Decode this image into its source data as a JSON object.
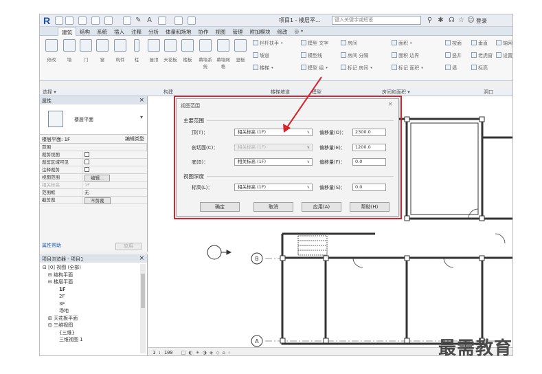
{
  "app": {
    "logo_letter": "R",
    "doc_title": "项目1 - 楼层平...",
    "help_search_placeholder": "键入关键字或短语",
    "login_label": "登录"
  },
  "ribbon": {
    "tabs": [
      "建筑",
      "结构",
      "系统",
      "插入",
      "注释",
      "分析",
      "体量和场地",
      "协作",
      "视图",
      "管理",
      "附加模块",
      "修改",
      "◎ •"
    ],
    "active_tab": "建筑",
    "buttons": [
      "修改",
      "墙",
      "门",
      "窗",
      "构件",
      "柱",
      "屋顶",
      "天花板",
      "楼板",
      "幕墙系统",
      "幕墙网格",
      "竖梃"
    ],
    "small_items": [
      "栏杆扶手 •",
      "坡道",
      "楼梯 •",
      "模型 文字",
      "模型线",
      "模型 组 •",
      "房间",
      "房间 分隔",
      "标记 房间 •",
      "面积 •",
      "面积 边界",
      "标记 面积 •",
      "按面",
      "竖井",
      "墙",
      "垂直",
      "老虎窗",
      "标高",
      "轴网",
      "设置"
    ],
    "panel_labels": [
      "选择 ▾",
      "构建",
      "楼梯坡道",
      "模型",
      "房间和面积 ▾",
      "洞口"
    ]
  },
  "properties": {
    "title": "属性",
    "type_name": "楼层平面",
    "instance_label": "楼层平面: 1F",
    "edit_type": "编辑类型",
    "section": "范围",
    "rows": [
      {
        "key": "裁剪视图",
        "value": "",
        "checkbox": true,
        "dim": false
      },
      {
        "key": "裁剪区域可见",
        "value": "",
        "checkbox": true,
        "dim": false
      },
      {
        "key": "注释裁剪",
        "value": "",
        "checkbox": true,
        "dim": false
      },
      {
        "key": "视图范围",
        "value": "编辑...",
        "button": true,
        "dim": false
      },
      {
        "key": "相关标高",
        "value": "1F",
        "dim": true
      },
      {
        "key": "范围框",
        "value": "无",
        "dim": false
      },
      {
        "key": "截剪裁",
        "value": "不剪裁",
        "button": true,
        "dim": false
      }
    ],
    "help_link": "属性帮助",
    "apply": "应用"
  },
  "browser": {
    "title": "项目浏览器 - 项目1",
    "tree": [
      {
        "text": "⊟ [0] 视图 (全部)",
        "indent": 0
      },
      {
        "text": "⊟ 结构平面",
        "indent": 1
      },
      {
        "text": "⊟ 楼层平面",
        "indent": 1
      },
      {
        "text": "1F",
        "indent": 3,
        "bold": true
      },
      {
        "text": "2F",
        "indent": 3
      },
      {
        "text": "3F",
        "indent": 3
      },
      {
        "text": "场地",
        "indent": 3
      },
      {
        "text": "⊞ 天花板平面",
        "indent": 1
      },
      {
        "text": "⊟ 三维视图",
        "indent": 1
      },
      {
        "text": "{三维}",
        "indent": 3
      },
      {
        "text": "三维视图 1",
        "indent": 3
      }
    ]
  },
  "canvas": {
    "grid_labels": [
      "B",
      "A"
    ],
    "status_scale": "1 : 100"
  },
  "dialog": {
    "title": "视图范围",
    "close": "×",
    "primary_range": "主要范围",
    "rows": [
      {
        "label": "顶(T)：",
        "select": "相关标高 (1F)",
        "offset_label": "偏移量(O)：",
        "offset": "2300.0",
        "disabled": false
      },
      {
        "label": "剖切面(C)：",
        "select": "相关标高 (1F)",
        "offset_label": "偏移量(E)：",
        "offset": "1200.0",
        "disabled": true
      },
      {
        "label": "底(B)：",
        "select": "相关标高 (1F)",
        "offset_label": "偏移量(F)：",
        "offset": "0.0",
        "disabled": false
      }
    ],
    "view_depth": "视图深度",
    "depth_row": {
      "label": "标高(L)：",
      "select": "相关标高 (1F)",
      "offset_label": "偏移量(S)：",
      "offset": "0.0"
    },
    "buttons": [
      "确定",
      "取消",
      "应用(A)",
      "帮助(H)"
    ]
  },
  "watermark": "最需教育",
  "colors": {
    "highlight": "#d8232a",
    "wall": "#333333"
  }
}
